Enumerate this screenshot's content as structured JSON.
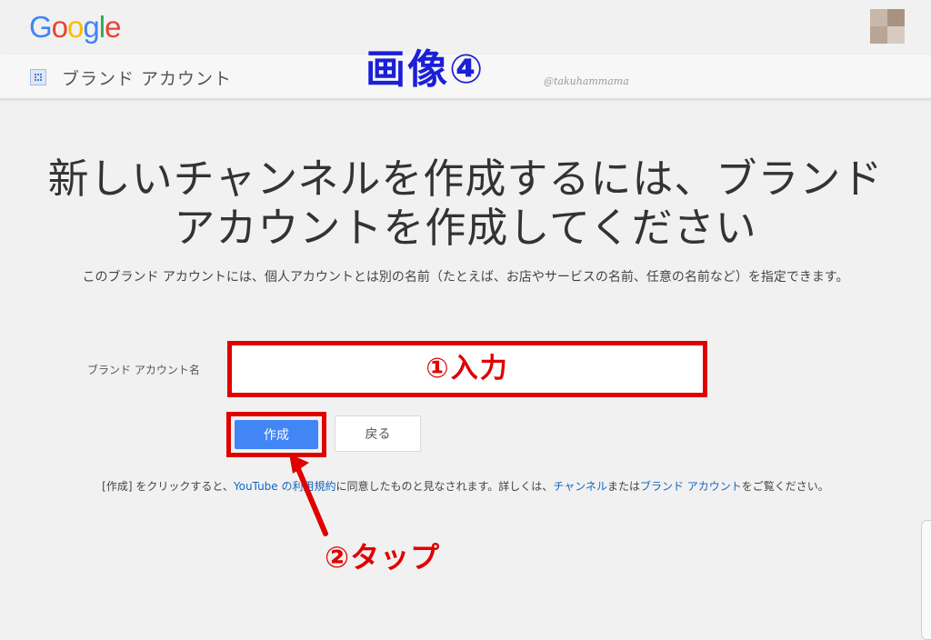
{
  "header": {
    "logo_letters": [
      "G",
      "o",
      "o",
      "g",
      "l",
      "e"
    ],
    "logo_colors": [
      "#4285F4",
      "#EA4335",
      "#FBBC05",
      "#4285F4",
      "#34A853",
      "#EA4335"
    ],
    "overlay_title": "画像④",
    "watermark": "@takuhammama"
  },
  "subbar": {
    "icon": "brand-account-icon",
    "title": "ブランド アカウント"
  },
  "main": {
    "heading_line1": "新しいチャンネルを作成するには、ブランド",
    "heading_line2": "アカウントを作成してください",
    "description": "このブランド アカウントには、個人アカウントとは別の名前（たとえば、お店やサービスの名前、任意の名前など）を指定できます。",
    "field_label": "ブランド アカウント名",
    "input_value": "",
    "input_annotation": "①入力",
    "create_label": "作成",
    "back_label": "戻る",
    "tap_annotation": "②タップ",
    "terms": {
      "part1": "[作成] をクリックすると、",
      "link_terms": "YouTube の利用規約",
      "part2": "に同意したものと見なされます。詳しくは、",
      "link_channel": "チャンネル",
      "part3": "または",
      "link_brand": "ブランド アカウント",
      "part4": "をご覧ください。"
    }
  },
  "colors": {
    "annotation_red": "#e00000",
    "primary_blue": "#4285f4",
    "link_blue": "#1565c0",
    "overlay_blue": "#1b1fd6"
  }
}
